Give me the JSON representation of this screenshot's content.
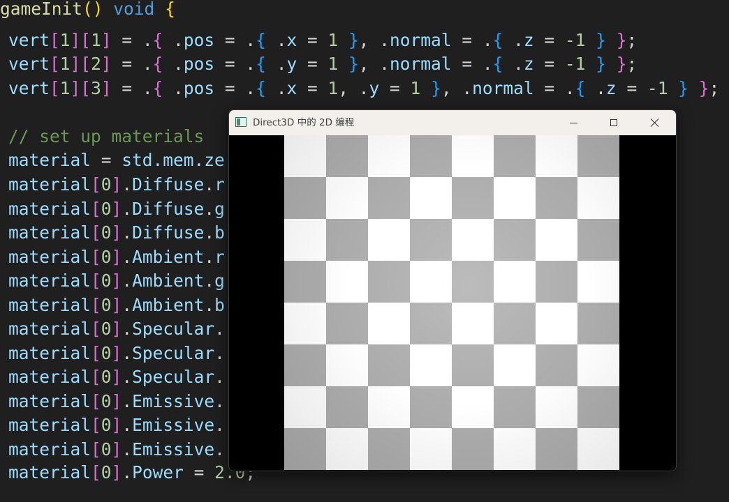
{
  "editor": {
    "line0": "gameInit() void {",
    "line1_end": "};",
    "l1_idx1": "1",
    "l1_idx2": "1",
    "l1_field": "x",
    "l1_val": "1",
    "l1_z": "-1",
    "l2_idx1": "1",
    "l2_idx2": "2",
    "l2_field": "y",
    "l2_val": "1",
    "l2_z": "-1",
    "l3_idx1": "1",
    "l3_idx2": "3",
    "l3_x": "1",
    "l3_y": "1",
    "l3_z": "-1",
    "comment": "// set up materials",
    "material_assign": "std.mem.ze",
    "material_lines": [
      {
        "field": "Diffuse",
        "tail": "r"
      },
      {
        "field": "Diffuse",
        "tail": "g"
      },
      {
        "field": "Diffuse",
        "tail": "b"
      },
      {
        "field": "Ambient",
        "tail": "r"
      },
      {
        "field": "Ambient",
        "tail": "g"
      },
      {
        "field": "Ambient",
        "tail": "b"
      },
      {
        "field": "Specular",
        "tail": ""
      },
      {
        "field": "Specular",
        "tail": ""
      },
      {
        "field": "Specular",
        "tail": ""
      },
      {
        "field": "Emissive",
        "tail": ""
      },
      {
        "field": "Emissive",
        "tail": ""
      },
      {
        "field": "Emissive",
        "tail": ""
      }
    ],
    "power_field": "Power",
    "power_value": "2.0"
  },
  "window": {
    "title": "Direct3D 中的 2D 编程",
    "icon": "app-window-icon",
    "controls": [
      "minimize-icon",
      "maximize-icon",
      "close-icon"
    ]
  },
  "board": {
    "rows": 8,
    "cols": 8,
    "light_color": "#ffffff",
    "dark_color": "#adadad",
    "background_color": "#000000"
  },
  "colors": {
    "editor_bg": "#1f1f1f",
    "variable": "#9cdcfe",
    "function": "#dcdcaa",
    "keyword": "#569cd6",
    "number": "#b5cea8",
    "comment": "#6a9955",
    "bracket_gold": "#ffd700",
    "bracket_pink": "#da70d6",
    "bracket_blue": "#179fff"
  }
}
